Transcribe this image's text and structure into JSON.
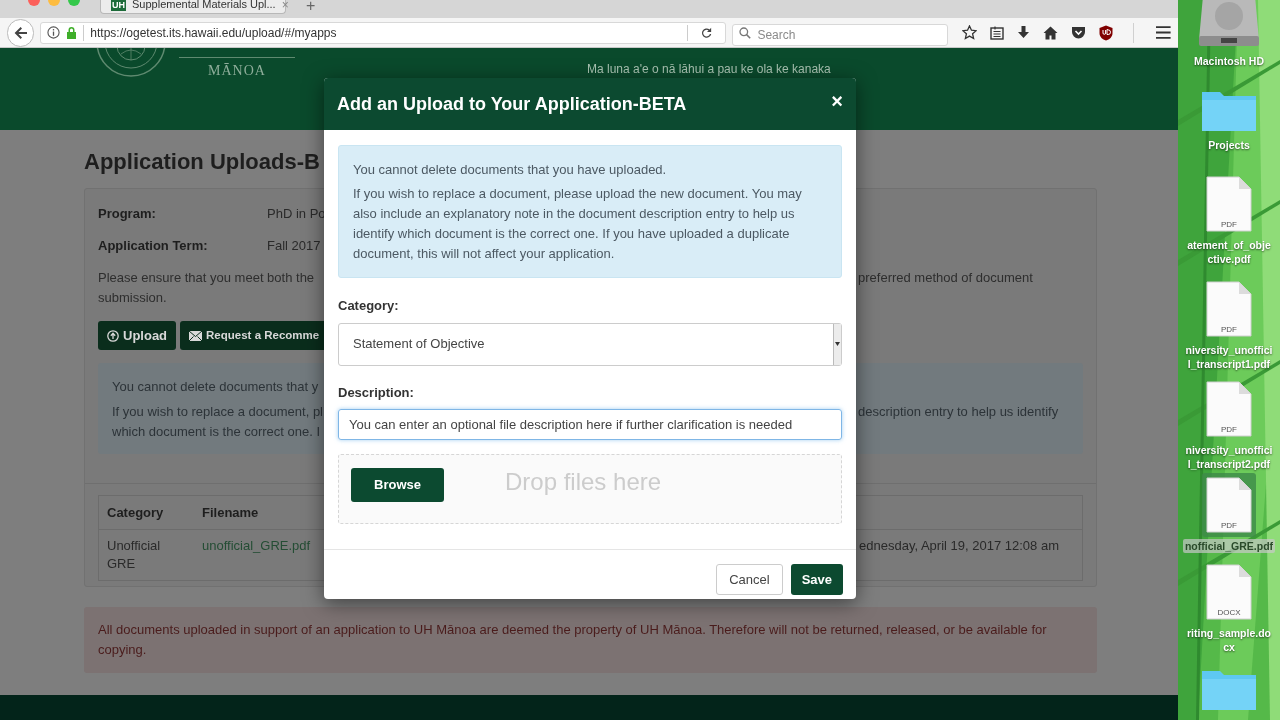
{
  "browser": {
    "tab": {
      "favicon": "UH",
      "title": "Supplemental Materials Upl...",
      "close": "×"
    },
    "new_tab": "+",
    "url": "https://ogetest.its.hawaii.edu/upload/#/myapps",
    "search": {
      "placeholder": "Search"
    }
  },
  "header": {
    "wordmark": "MĀNOA",
    "motto": "Ma luna a'e o nā lāhui a pau ke ola ke kanaka"
  },
  "page": {
    "title": "Application Uploads-B",
    "fields": [
      {
        "label": "Program:",
        "value": "PhD in Po"
      },
      {
        "label": "Application Term:",
        "value": "Fall 2017"
      }
    ],
    "notice": {
      "line_1_left": "Please ensure that you meet both the",
      "line_1_right": "preferred method of document",
      "line_2": "submission."
    },
    "buttons": [
      {
        "kind": "upload",
        "label": "Upload"
      },
      {
        "kind": "mail",
        "label": "Request a Recomme"
      }
    ],
    "info": {
      "line_1": "You cannot delete documents that y",
      "line_2_left": "If you wish to replace a document, pl",
      "line_2_right": "description entry to help us identify",
      "line_3": "which document is the correct one. I"
    },
    "table": {
      "columns": [
        "Category",
        "Filename"
      ],
      "rows": [
        {
          "category": "Unofficial GRE",
          "filename": "unofficial_GRE.pdf",
          "column_last": "ednesday, April 19, 2017 12:08 am"
        }
      ]
    },
    "property_note": "All documents uploaded in support of an application to UH Mānoa are deemed the property of UH Mānoa. Therefore will not be returned, released, or be available for copying."
  },
  "modal": {
    "title": "Add an Upload to Your Application-BETA",
    "close": "×",
    "info": [
      "You cannot delete documents that you have uploaded.",
      "If you wish to replace a document, please upload the new document. You may also include an explanatory note in the document description entry to help us identify which document is the correct one. If you have uploaded a duplicate document, this will not affect your application."
    ],
    "category": {
      "label": "Category:",
      "value": "Statement of Objective"
    },
    "description": {
      "label": "Description:",
      "value": "You can enter an optional file description here if further clarification is needed"
    },
    "dropzone": {
      "button": "Browse",
      "hint": "Drop files here"
    },
    "buttons": [
      {
        "kind": "secondary",
        "label": "Cancel"
      },
      {
        "kind": "primary",
        "label": "Save"
      }
    ]
  },
  "desktop": {
    "items": [
      {
        "kind": "drive",
        "label_lines": [
          "Macintosh HD"
        ],
        "selected": false
      },
      {
        "kind": "folder",
        "label_lines": [
          "Projects"
        ],
        "selected": false
      },
      {
        "kind": "document",
        "badge": "PDF",
        "label_lines": [
          "atement_of_obje",
          "ctive.pdf"
        ],
        "selected": false
      },
      {
        "kind": "document",
        "badge": "PDF",
        "label_lines": [
          "niversity_unoffici",
          "l_transcript1.pdf"
        ],
        "selected": false
      },
      {
        "kind": "document",
        "badge": "PDF",
        "label_lines": [
          "niversity_unoffici",
          "l_transcript2.pdf"
        ],
        "selected": false
      },
      {
        "kind": "document",
        "badge": "PDF",
        "label_lines": [
          "nofficial_GRE.pdf"
        ],
        "selected": true
      },
      {
        "kind": "document",
        "badge": "DOCX",
        "label_lines": [
          "riting_sample.do",
          "cx"
        ],
        "selected": false
      },
      {
        "kind": "folder",
        "selected": false
      }
    ]
  }
}
